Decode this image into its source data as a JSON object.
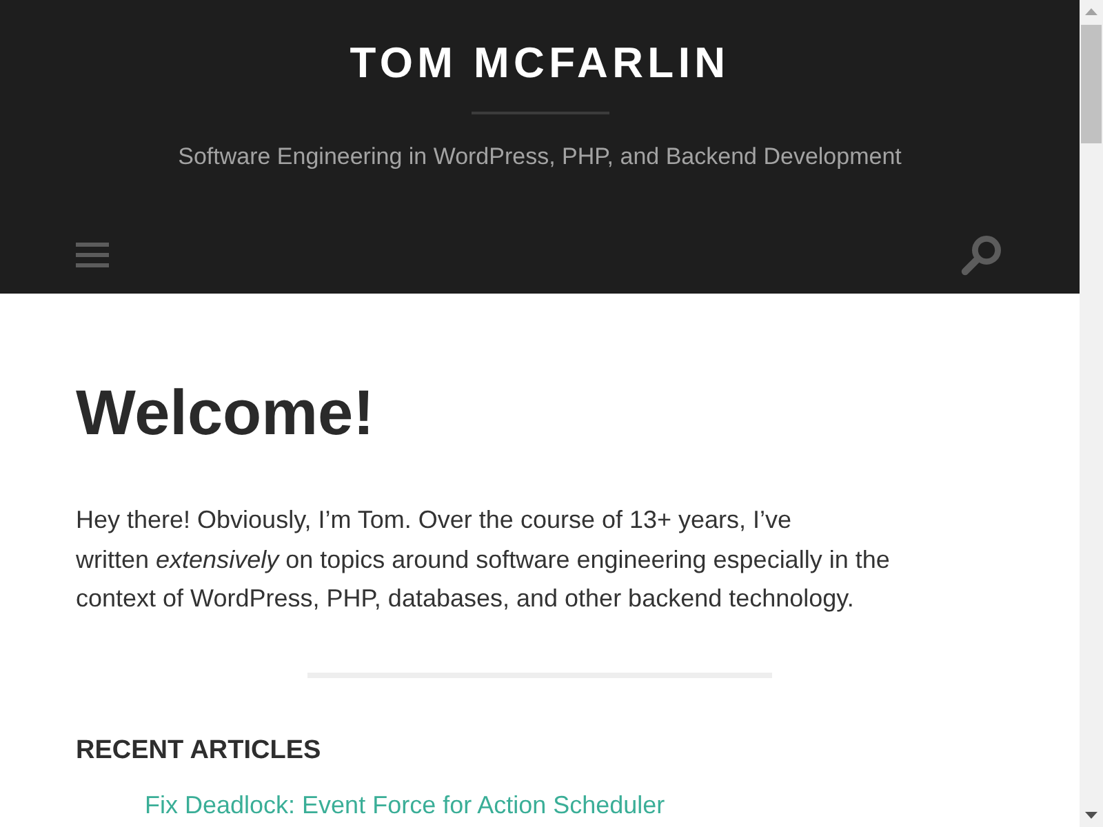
{
  "site": {
    "title": "TOM MCFARLIN",
    "tagline": "Software Engineering in WordPress, PHP, and Backend Development"
  },
  "page": {
    "heading": "Welcome!",
    "intro": "Hey there! Obviously, I’m Tom. Over the course of 13+ years, I’ve\nwritten *extensively* on topics around software engineering especially in the context of WordPress, PHP, databases, and other backend technology."
  },
  "recent_articles": {
    "heading": "RECENT ARTICLES",
    "items": [
      {
        "title": "Fix Deadlock: Event Force for Action Scheduler"
      }
    ]
  }
}
